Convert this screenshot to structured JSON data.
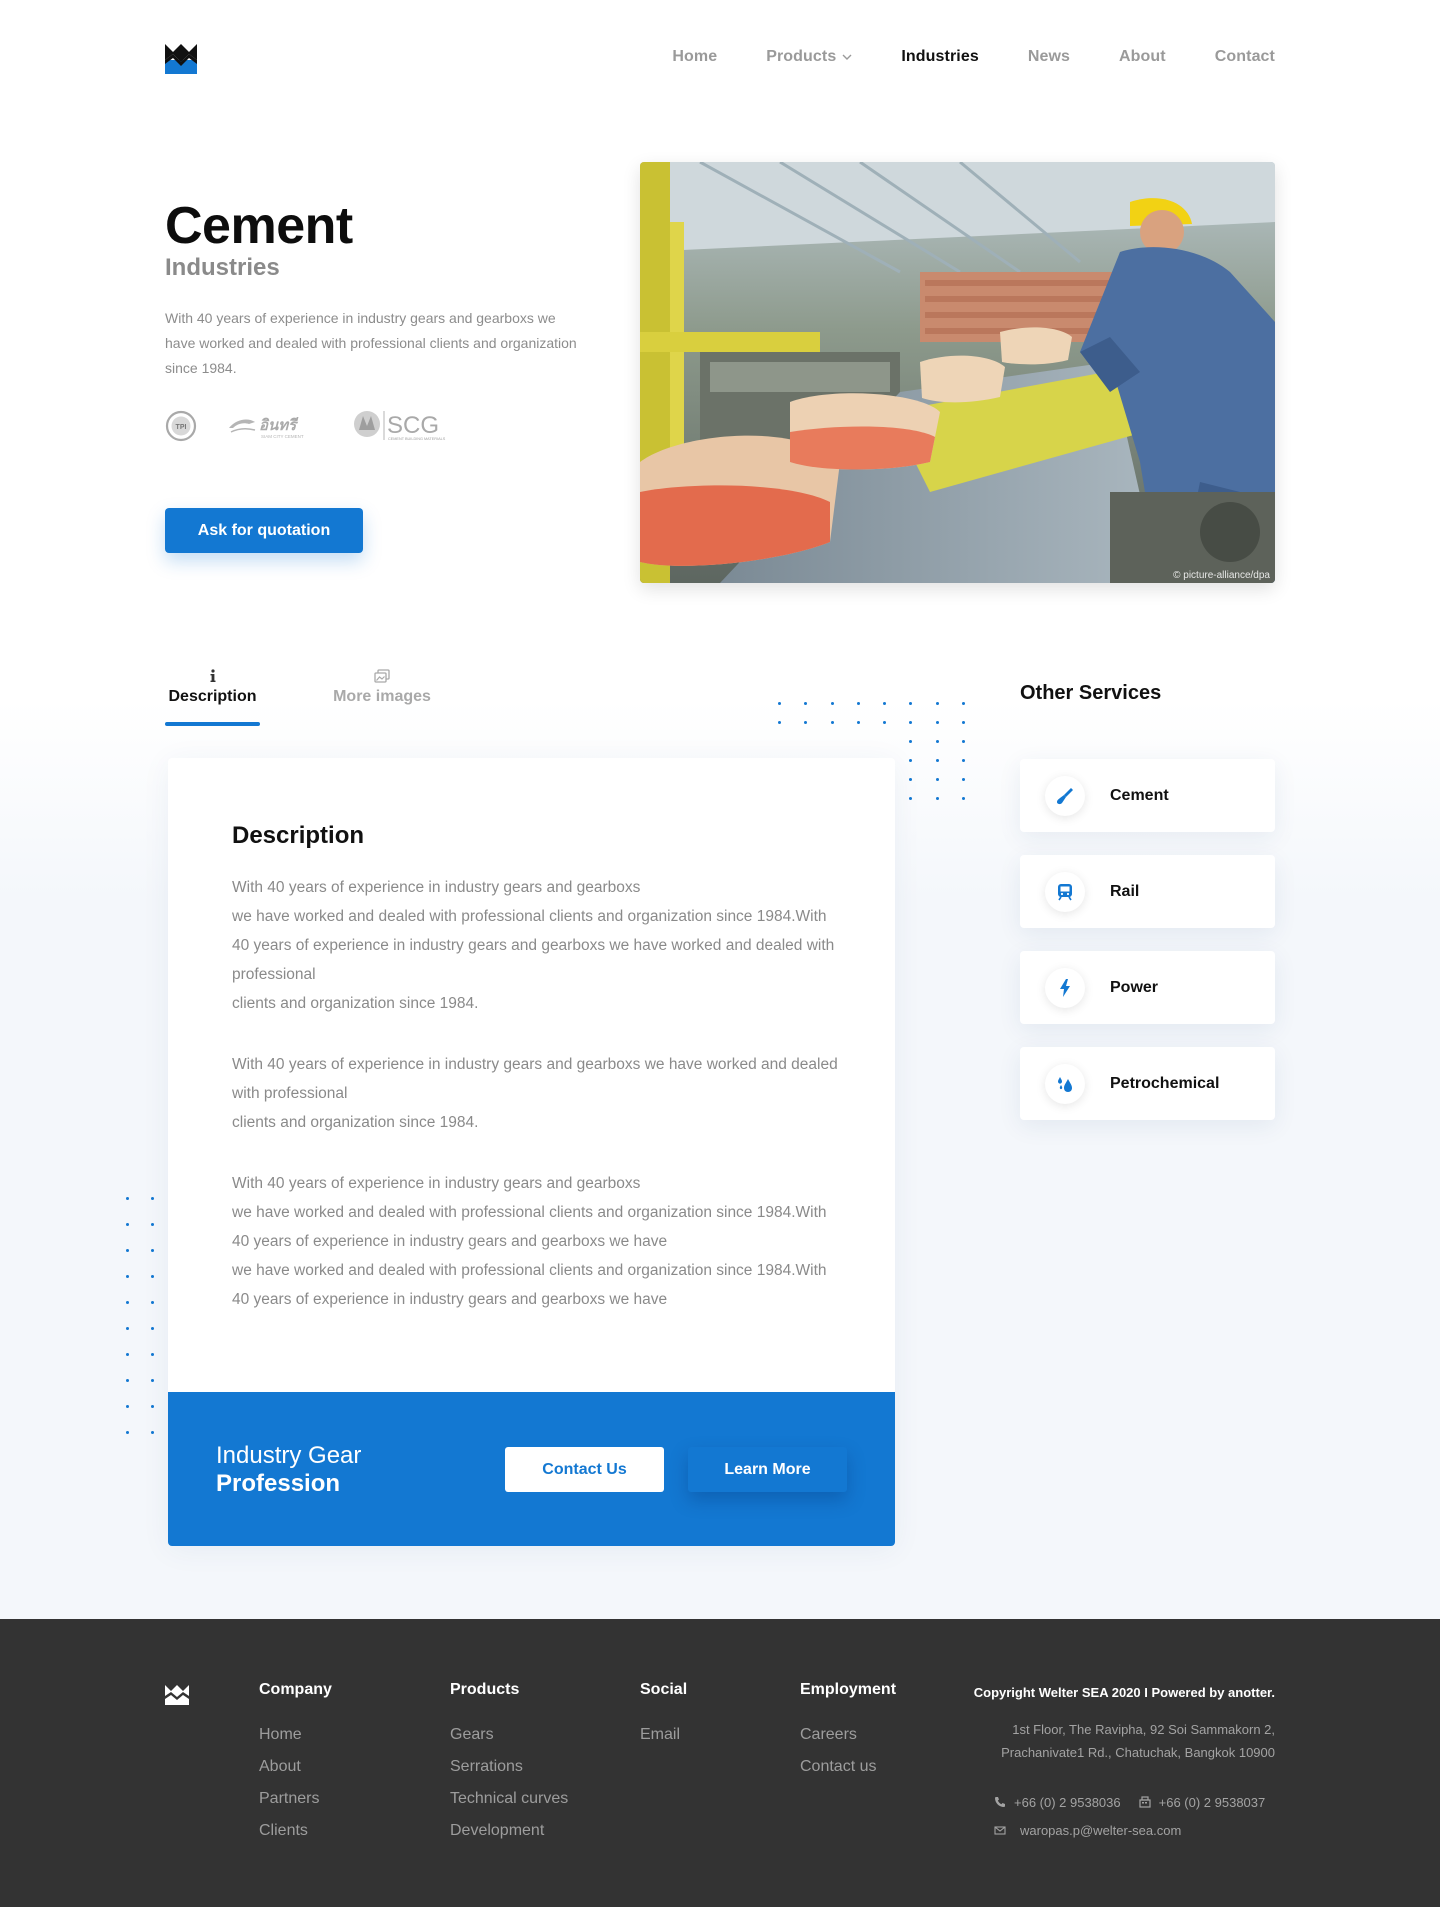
{
  "nav": {
    "items": [
      {
        "label": "Home",
        "active": false
      },
      {
        "label": "Products",
        "active": false,
        "dropdown": true
      },
      {
        "label": "Industries",
        "active": true
      },
      {
        "label": "News",
        "active": false
      },
      {
        "label": "About",
        "active": false
      },
      {
        "label": "Contact",
        "active": false
      }
    ]
  },
  "hero": {
    "title": "Cement",
    "subtitle": "Industries",
    "description": "With 40 years  of experience in industry gears and gearboxs we have worked and dealed with professional clients and organization since 1984.",
    "partners": [
      {
        "text": "TPI",
        "icon": "tpi-logo"
      },
      {
        "text": "อินทรี",
        "subtext": "SIAM CITY CEMENT",
        "icon": "insee-logo"
      },
      {
        "text": "SCG",
        "subtext": "CEMENT BUILDING MATERIALS",
        "icon": "scg-logo"
      }
    ],
    "cta_label": "Ask for quotation",
    "image_credit": "© picture-alliance/dpa",
    "image_icon": "cement-factory-photo"
  },
  "tabs": [
    {
      "label": "Description",
      "icon": "info-icon",
      "active": true
    },
    {
      "label": "More images",
      "icon": "images-icon",
      "active": false
    }
  ],
  "description": {
    "title": "Description",
    "paragraphs": [
      "With 40 years  of experience in industry gears and gearboxs\nwe have worked and dealed with professional clients and organization since 1984.With 40 years  of experience in industry gears and gearboxs we have worked and dealed with professional\nclients and organization since 1984.",
      "With 40 years  of experience in industry gears and gearboxs we have worked and dealed with professional\nclients and organization since 1984.",
      "With 40 years  of experience in industry gears and gearboxs\nwe have worked and dealed with professional clients and organization since 1984.With 40 years  of experience in industry gears and gearboxs we have\nwe have worked and dealed with professional clients and organization since 1984.With 40 years  of experience in industry gears and gearboxs we have"
    ]
  },
  "cta": {
    "line1": "Industry Gear",
    "line2": "Profession",
    "contact_label": "Contact Us",
    "learn_label": "Learn More"
  },
  "services": {
    "title": "Other Services",
    "items": [
      {
        "label": "Cement",
        "icon": "trowel-icon"
      },
      {
        "label": "Rail",
        "icon": "train-icon"
      },
      {
        "label": "Power",
        "icon": "lightning-icon"
      },
      {
        "label": "Petrochemical",
        "icon": "droplets-icon"
      }
    ]
  },
  "footer": {
    "columns": [
      {
        "title": "Company",
        "links": [
          "Home",
          "About",
          "Partners",
          "Clients"
        ]
      },
      {
        "title": "Products",
        "links": [
          "Gears",
          "Serrations",
          "Technical curves",
          "Development"
        ]
      },
      {
        "title": "Social",
        "links": [
          "Email"
        ]
      },
      {
        "title": "Employment",
        "links": [
          "Careers",
          "Contact us"
        ]
      }
    ],
    "copyright": "Copyright Welter SEA 2020 I Powered by anotter.",
    "address_line1": "1st Floor, The Ravipha, 92 Soi Sammakorn 2,",
    "address_line2": "Prachanivate1 Rd., Chatuchak, Bangkok 10900",
    "phone": "+66 (0) 2 9538036",
    "fax": "+66 (0) 2 9538037",
    "email": "waropas.p@welter-sea.com"
  },
  "colors": {
    "accent": "#1378d2",
    "footer_bg": "#333333",
    "text_muted": "#8a8a8a"
  }
}
